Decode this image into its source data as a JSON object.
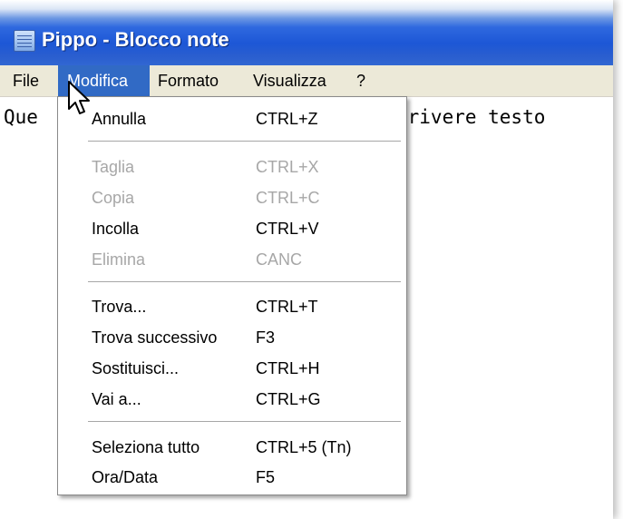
{
  "window": {
    "title": "Pippo - Blocco note",
    "app_icon": "notepad-icon"
  },
  "menubar": {
    "items": [
      "File",
      "Modifica",
      "Formato",
      "Visualizza",
      "?"
    ],
    "active": "Modifica"
  },
  "editor": {
    "visible_text_left": "Que",
    "visible_text_right": "crivere testo"
  },
  "edit_menu": {
    "items": [
      {
        "label": "Annulla",
        "shortcut": "CTRL+Z",
        "enabled": true
      },
      {
        "label": "Taglia",
        "shortcut": "CTRL+X",
        "enabled": false
      },
      {
        "label": "Copia",
        "shortcut": "CTRL+C",
        "enabled": false
      },
      {
        "label": "Incolla",
        "shortcut": "CTRL+V",
        "enabled": true
      },
      {
        "label": "Elimina",
        "shortcut": "CANC",
        "enabled": false
      },
      {
        "label": "Trova...",
        "shortcut": "CTRL+T",
        "enabled": true
      },
      {
        "label": "Trova successivo",
        "shortcut": "F3",
        "enabled": true
      },
      {
        "label": "Sostituisci...",
        "shortcut": "CTRL+H",
        "enabled": true
      },
      {
        "label": "Vai a...",
        "shortcut": "CTRL+G",
        "enabled": true
      },
      {
        "label": "Seleziona tutto",
        "shortcut": "CTRL+5 (Tn)",
        "enabled": true
      },
      {
        "label": "Ora/Data",
        "shortcut": "F5",
        "enabled": true
      }
    ]
  },
  "colors": {
    "titlebar": "#1d57d6",
    "menu_highlight": "#316ac5",
    "menubar_bg": "#ece9d8",
    "disabled_text": "#a7a7a7"
  },
  "cursor": "mouse-pointer-icon"
}
